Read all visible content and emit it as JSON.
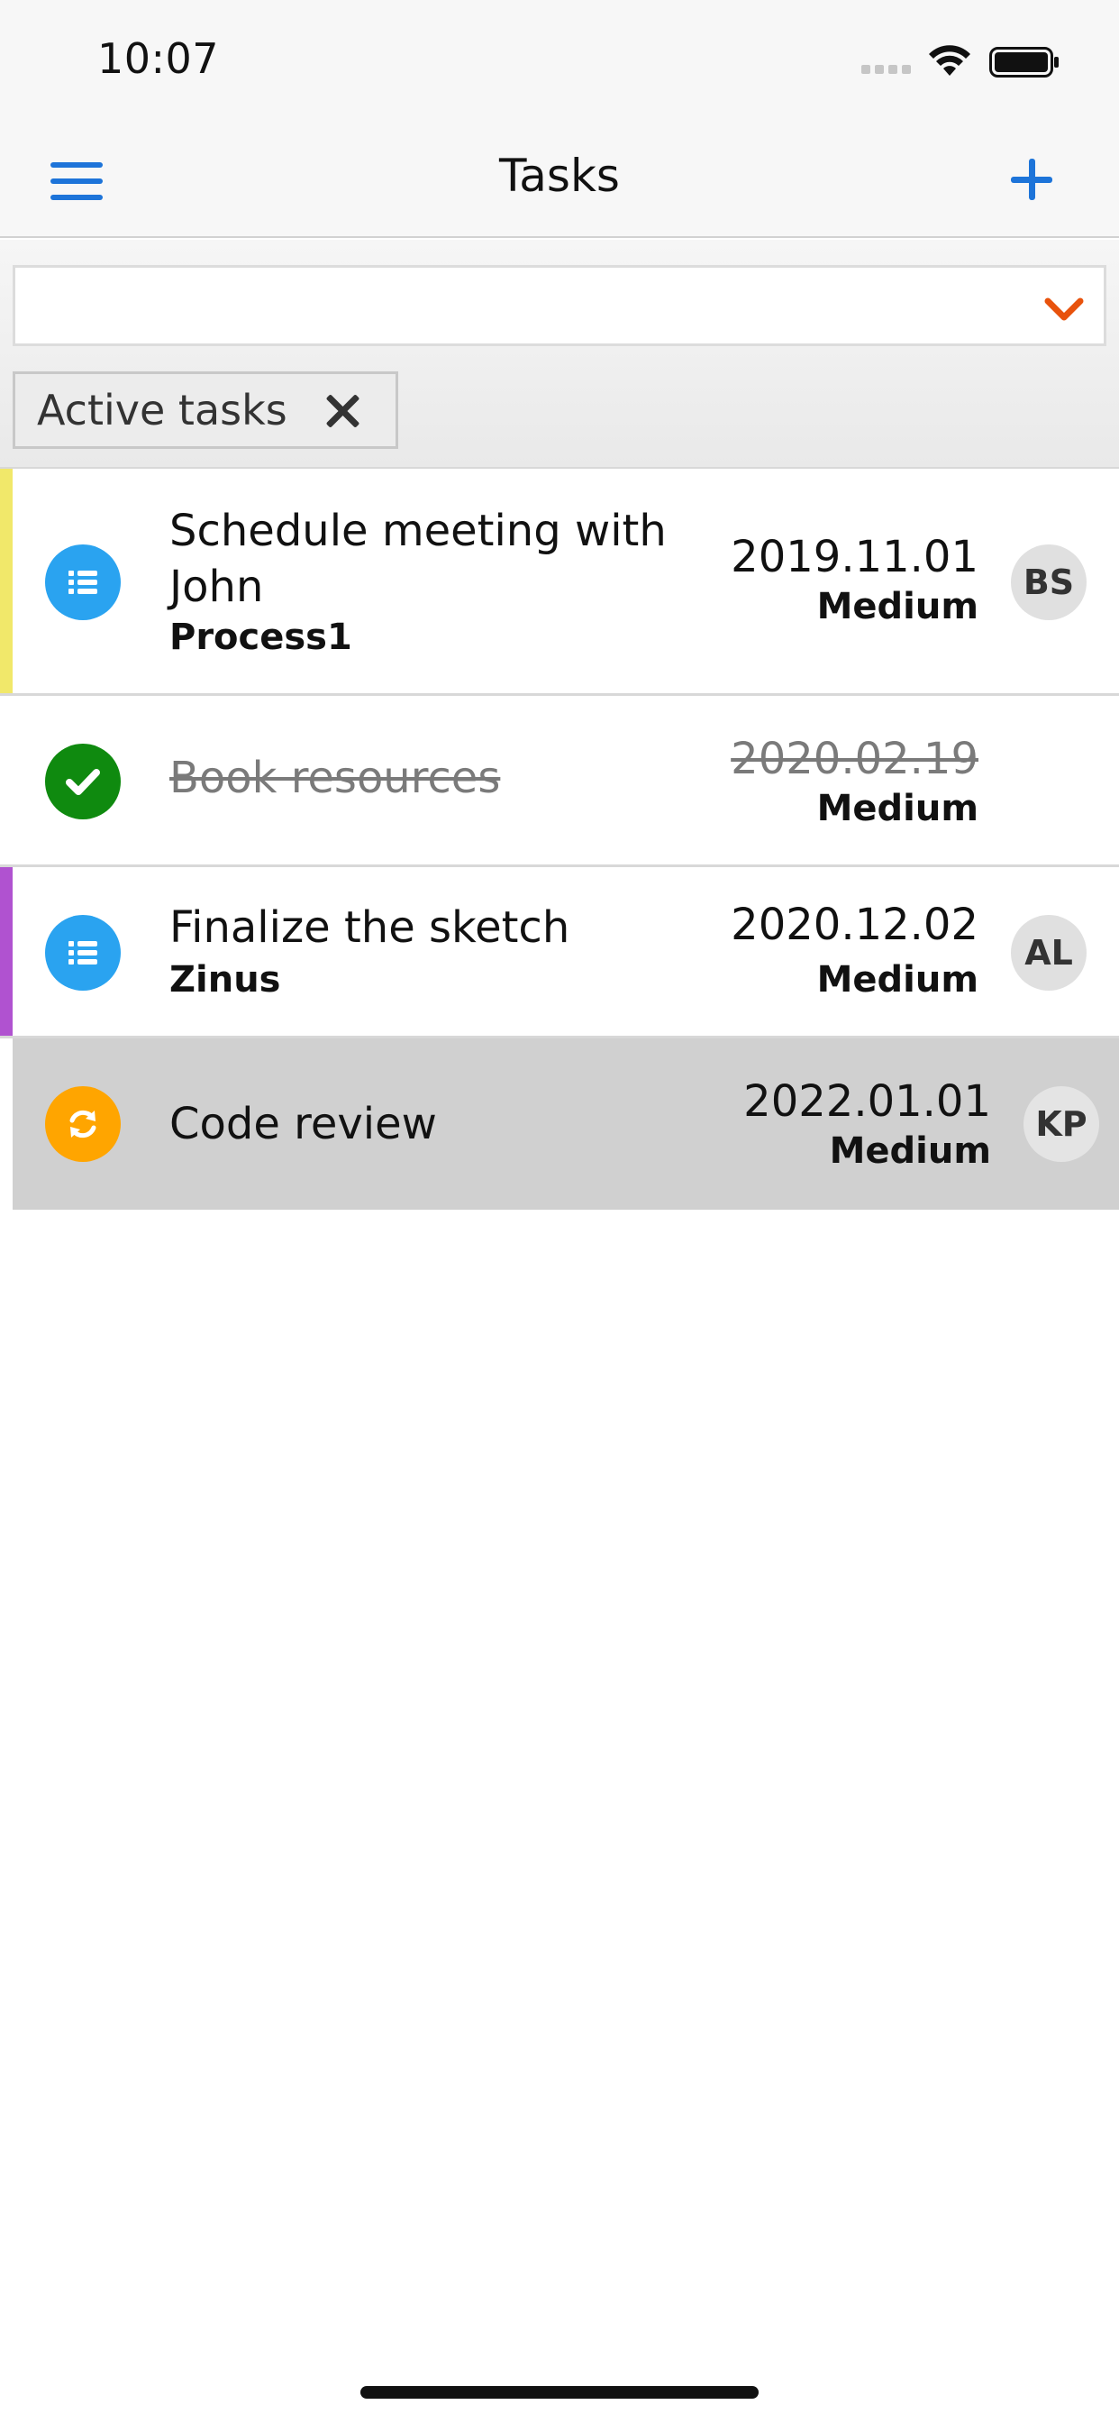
{
  "status_bar": {
    "time": "10:07",
    "icons": [
      "signal-dots-icon",
      "wifi-icon",
      "battery-icon"
    ]
  },
  "nav": {
    "title": "Tasks",
    "menu_icon": "hamburger-menu-icon",
    "add_icon": "plus-icon"
  },
  "filter": {
    "select_value": "",
    "chevron_icon": "chevron-down-icon",
    "chip_label": "Active tasks",
    "chip_close_icon": "close-icon"
  },
  "colors": {
    "accent": "#1d74d9",
    "chevron": "#e8520c",
    "blue_status": "#2aa3f0",
    "done_status": "#0f8a0f",
    "orange_status": "#ffa500",
    "accent_yellow": "#f1e86a",
    "accent_purple": "#b052d0"
  },
  "tasks": [
    {
      "title": "Schedule meeting with John",
      "subtitle": "Process1",
      "date": "2019.11.01",
      "priority": "Medium",
      "assignee": "BS",
      "status_icon": "list-icon",
      "accent": "#f1e86a",
      "done": false
    },
    {
      "title": "Book resources",
      "subtitle": "",
      "date": "2020.02.19",
      "priority": "Medium",
      "assignee": "",
      "status_icon": "check-icon",
      "accent": "",
      "done": true
    },
    {
      "title": "Finalize the sketch",
      "subtitle": "Zinus",
      "date": "2020.12.02",
      "priority": "Medium",
      "assignee": "AL",
      "status_icon": "list-icon",
      "accent": "#b052d0",
      "done": false
    },
    {
      "title": "Code review",
      "subtitle": "",
      "date": "2022.01.01",
      "priority": "Medium",
      "assignee": "KP",
      "status_icon": "refresh-icon",
      "accent": "",
      "done": false
    }
  ]
}
